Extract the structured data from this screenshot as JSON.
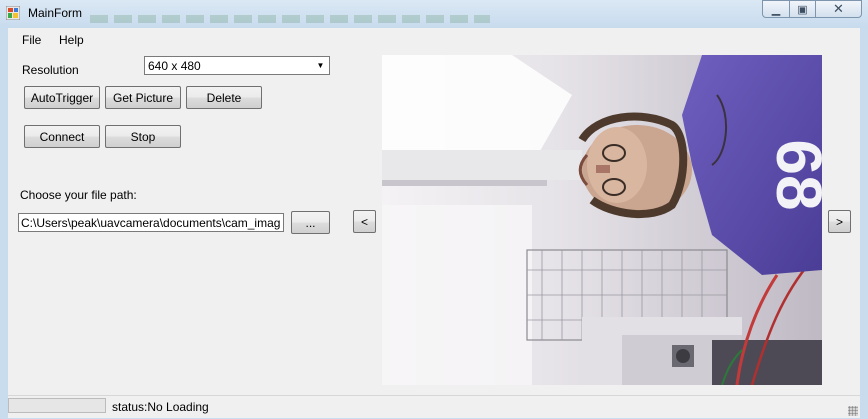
{
  "window": {
    "title": "MainForm"
  },
  "menu": {
    "items": [
      "File",
      "Help"
    ]
  },
  "resolution": {
    "label": "Resolution",
    "selected": "640 x 480"
  },
  "buttons": {
    "autotrigger": "AutoTrigger",
    "get_picture": "Get Picture",
    "delete": "Delete",
    "connect": "Connect",
    "stop": "Stop",
    "browse": "...",
    "prev": "<",
    "next": ">"
  },
  "filepath": {
    "label": "Choose your file path:",
    "value": "C:\\Users\\peak\\uavcamera\\documents\\cam_images"
  },
  "status": {
    "text": "status:No Loading"
  },
  "preview": {
    "shirt_number": "68"
  }
}
